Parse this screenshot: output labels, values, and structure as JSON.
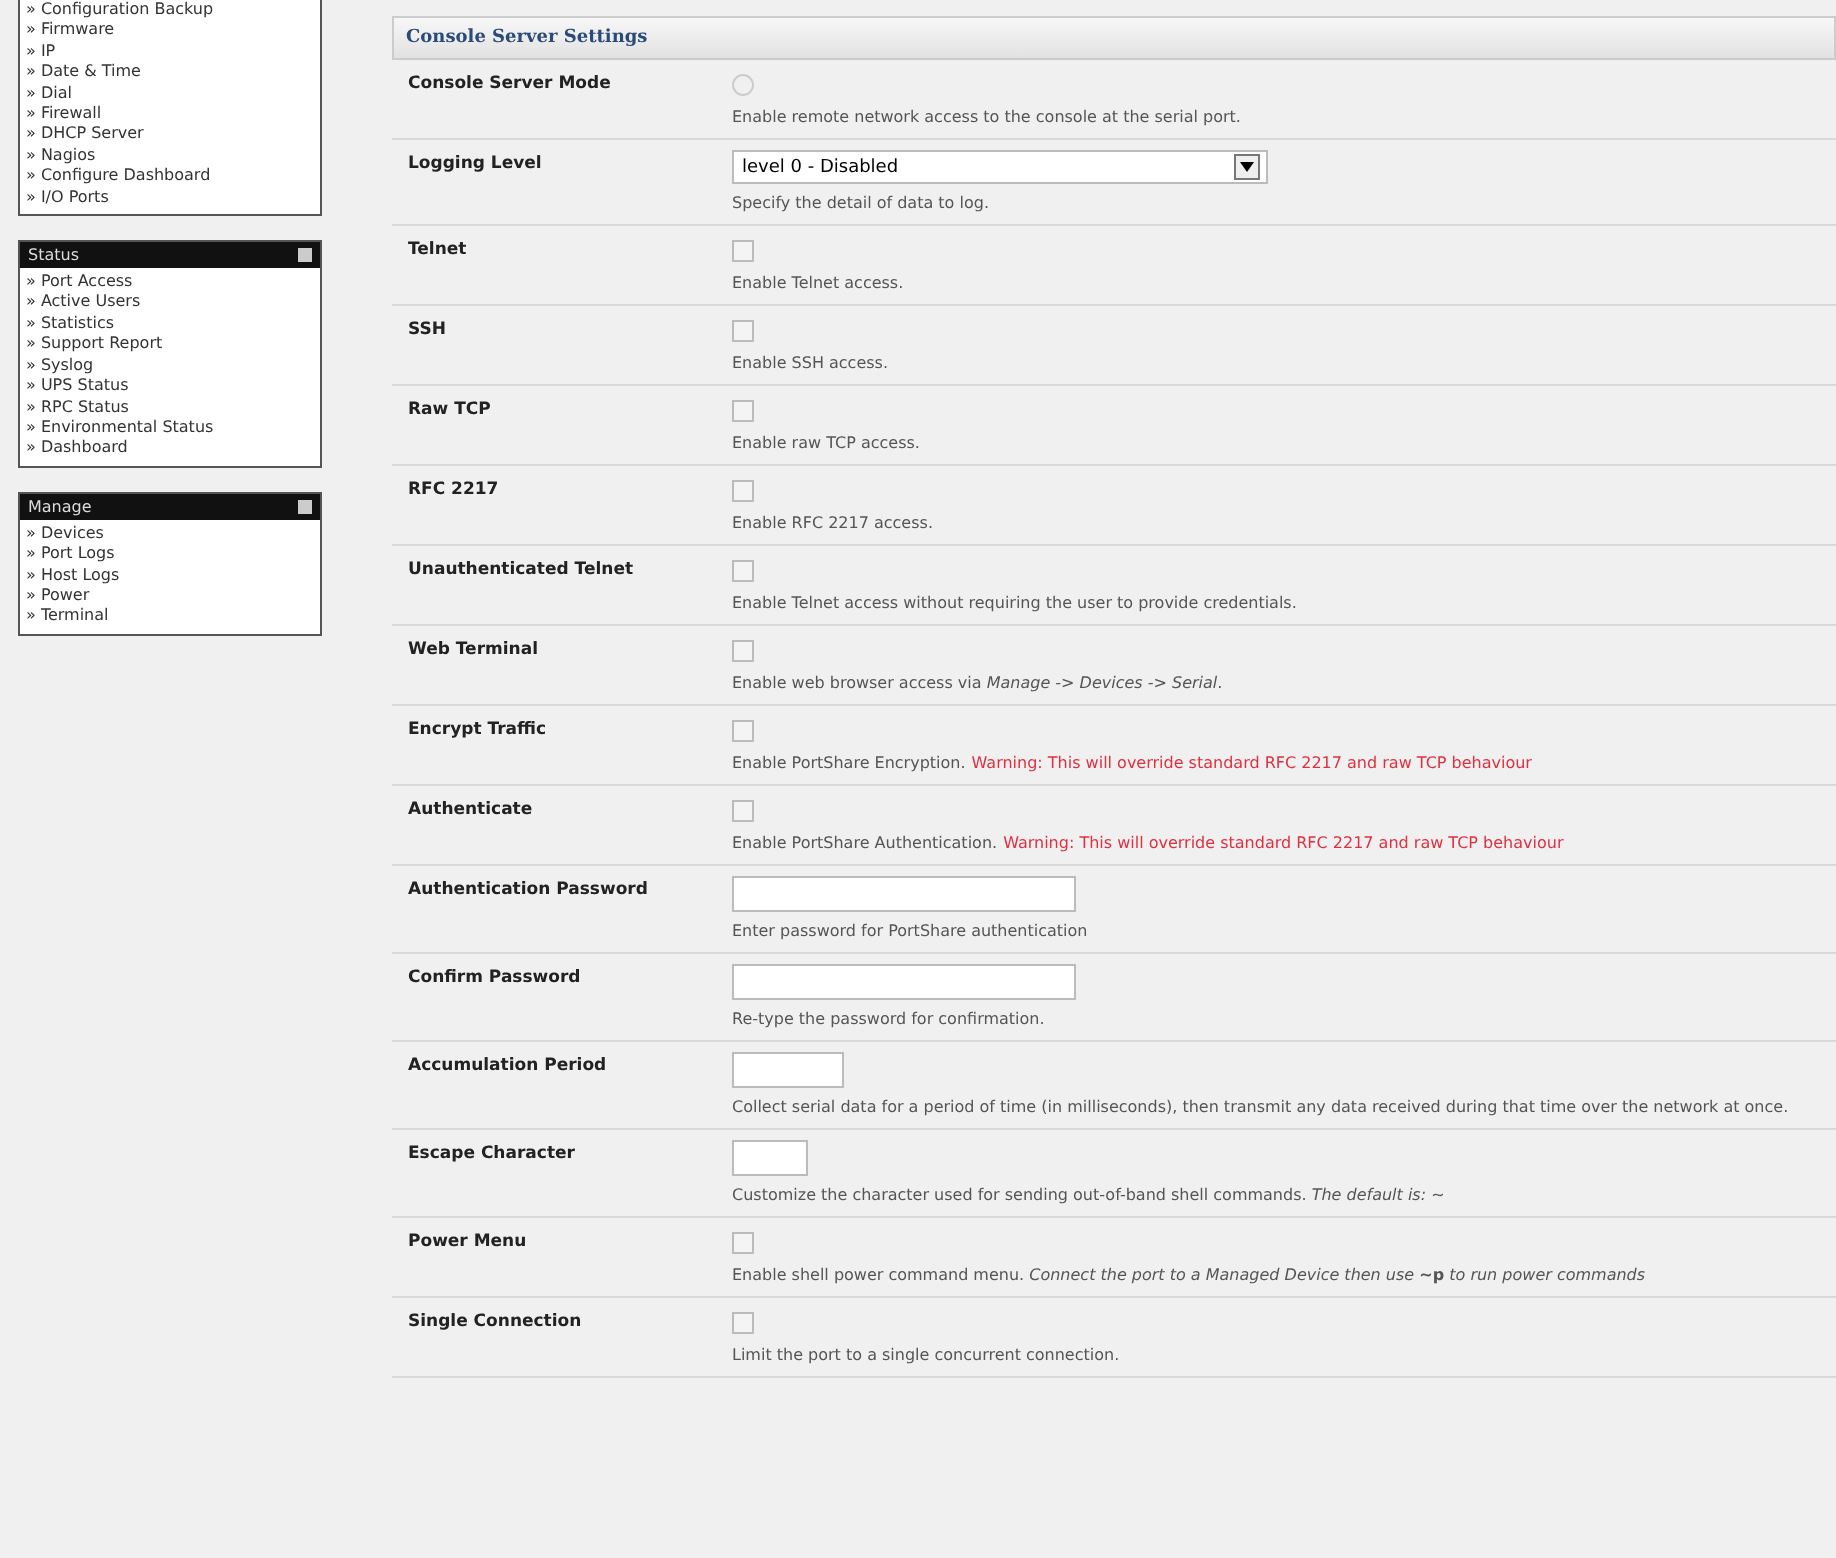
{
  "sidebar": {
    "sections": [
      {
        "items": [
          "» Configuration Backup",
          "» Firmware",
          "» IP",
          "» Date & Time",
          "» Dial",
          "» Firewall",
          "» DHCP Server",
          "» Nagios",
          "» Configure Dashboard",
          "» I/O Ports"
        ]
      },
      {
        "title": "Status",
        "items": [
          "» Port Access",
          "» Active Users",
          "» Statistics",
          "» Support Report",
          "» Syslog",
          "» UPS Status",
          "» RPC Status",
          "» Environmental Status",
          "» Dashboard"
        ]
      },
      {
        "title": "Manage",
        "items": [
          "» Devices",
          "» Port Logs",
          "» Host Logs",
          "» Power",
          "» Terminal"
        ]
      }
    ]
  },
  "settings": {
    "title": "Console Server Settings",
    "rows": [
      {
        "label": "Console Server Mode",
        "kind": "radio",
        "checked": false,
        "description": "Enable remote network access to the console at the serial port."
      },
      {
        "label": "Logging Level",
        "kind": "select",
        "value": "level 0 - Disabled",
        "description": "Specify the detail of data to log."
      },
      {
        "label": "Telnet",
        "kind": "checkbox",
        "checked": false,
        "description": "Enable Telnet access."
      },
      {
        "label": "SSH",
        "kind": "checkbox",
        "checked": false,
        "description": "Enable SSH access."
      },
      {
        "label": "Raw TCP",
        "kind": "checkbox",
        "checked": false,
        "description": "Enable raw TCP access."
      },
      {
        "label": "RFC 2217",
        "kind": "checkbox",
        "checked": false,
        "description": "Enable RFC 2217 access."
      },
      {
        "label": "Unauthenticated Telnet",
        "kind": "checkbox",
        "checked": false,
        "description": "Enable Telnet access without requiring the user to provide credentials."
      },
      {
        "label": "Web Terminal",
        "kind": "checkbox",
        "checked": false,
        "description": "Enable web browser access via *Manage -> Devices -> Serial*."
      },
      {
        "label": "Encrypt Traffic",
        "kind": "checkbox",
        "checked": false,
        "description": "Enable PortShare Encryption.",
        "warning": "Warning: This will override standard RFC 2217 and raw TCP behaviour"
      },
      {
        "label": "Authenticate",
        "kind": "checkbox",
        "checked": false,
        "description": "Enable PortShare Authentication.",
        "warning": "Warning: This will override standard RFC 2217 and raw TCP behaviour"
      },
      {
        "label": "Authentication Password",
        "kind": "password",
        "description": "Enter password for PortShare authentication"
      },
      {
        "label": "Confirm Password",
        "kind": "password",
        "description": "Re-type the password for confirmation."
      },
      {
        "label": "Accumulation Period",
        "kind": "text",
        "description": "Collect serial data for a period of time (in milliseconds), then transmit any data received during that time over the network at once."
      },
      {
        "label": "Escape Character",
        "kind": "char",
        "description": "Customize the character used for sending out-of-band shell commands. *The default is: ~*"
      },
      {
        "label": "Power Menu",
        "kind": "checkbox",
        "checked": false,
        "description": "Enable shell power command menu. *Connect the port to a Managed Device then use* **~p** *to run power commands*"
      },
      {
        "label": "Single Connection",
        "kind": "checkbox",
        "checked": false,
        "description": "Limit the port to a single concurrent connection."
      }
    ]
  }
}
